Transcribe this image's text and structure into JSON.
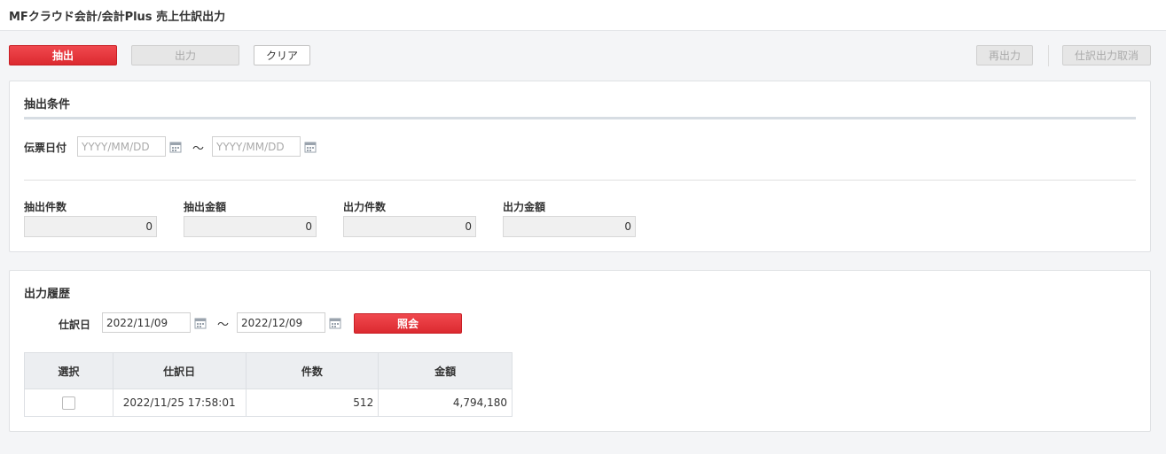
{
  "header": {
    "title": "MFクラウド会計/会計Plus 売上仕訳出力"
  },
  "toolbar": {
    "extract_label": "抽出",
    "output_label": "出力",
    "clear_label": "クリア",
    "reoutput_label": "再出力",
    "cancel_output_label": "仕訳出力取消"
  },
  "conditions": {
    "title": "抽出条件",
    "date_label": "伝票日付",
    "date_from": {
      "value": "",
      "placeholder": "YYYY/MM/DD"
    },
    "date_to": {
      "value": "",
      "placeholder": "YYYY/MM/DD"
    },
    "separator": "～",
    "summary": [
      {
        "label": "抽出件数",
        "value": "0"
      },
      {
        "label": "抽出金額",
        "value": "0"
      },
      {
        "label": "出力件数",
        "value": "0"
      },
      {
        "label": "出力金額",
        "value": "0"
      }
    ]
  },
  "history": {
    "title": "出力履歴",
    "date_label": "仕訳日",
    "date_from": "2022/11/09",
    "date_to": "2022/12/09",
    "separator": "～",
    "search_label": "照会",
    "columns": [
      "選択",
      "仕訳日",
      "件数",
      "金額"
    ],
    "rows": [
      {
        "selected": false,
        "date": "2022/11/25 17:58:01",
        "count": "512",
        "amount": "4,794,180"
      }
    ]
  },
  "colors": {
    "accent_red": "#e3323a",
    "panel_border": "#dfe1e4"
  },
  "icons": {
    "calendar": "calendar-icon",
    "checkbox": "checkbox-icon"
  }
}
